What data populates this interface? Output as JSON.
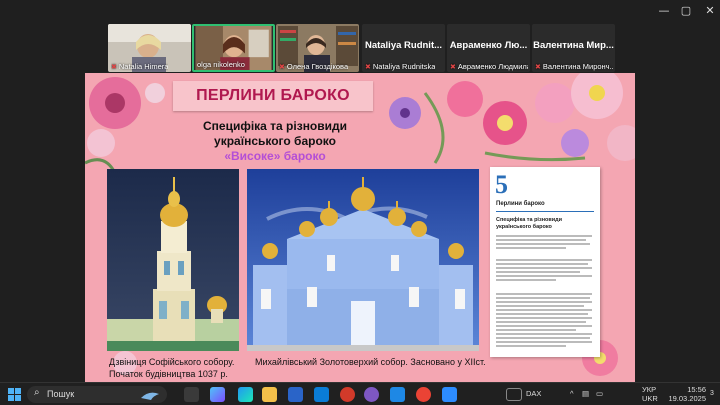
{
  "window_controls": {
    "minimize": "—",
    "maximize": "▢",
    "close": "✕"
  },
  "participants": [
    {
      "name": "Natalia Himera"
    },
    {
      "name": "olga nikolenko"
    },
    {
      "name": "Олена Гвоздікова"
    },
    {
      "name": "Nataliya Rudnitska",
      "big": "Nataliya Rudnit..."
    },
    {
      "name": "Авраменко Людмила",
      "big": "Авраменко Лю..."
    },
    {
      "name": "Валентина Миронч...",
      "big": "Валентина Мир..."
    }
  ],
  "slide": {
    "title": "ПЕРЛИНИ БАРОКО",
    "subtitle": "Специфіка та різновиди українського бароко",
    "subtitle2": "«Високе» бароко",
    "caption_left_1": "Дзвіниця Софійського собору.",
    "caption_left_2": "Початок будівництва 1037 р.",
    "caption_center": "Михайлівський Золотоверхий собор. Засновано у ХІІст.",
    "book": {
      "number": "5",
      "heading": "Перлини бароко",
      "section": "Специфіка та різновиди українського бароко"
    }
  },
  "taskbar": {
    "search_placeholder": "Пошук",
    "dax": "DAX",
    "lang1": "УКР",
    "lang2": "UKR",
    "time": "15:56",
    "date": "19.03.2025",
    "notif": "3"
  },
  "colors": {
    "slide_bg": "#f4a6b2",
    "title_color": "#b0184f",
    "accent_purple": "#b44fd6",
    "active_tile": "#2fbf71"
  }
}
